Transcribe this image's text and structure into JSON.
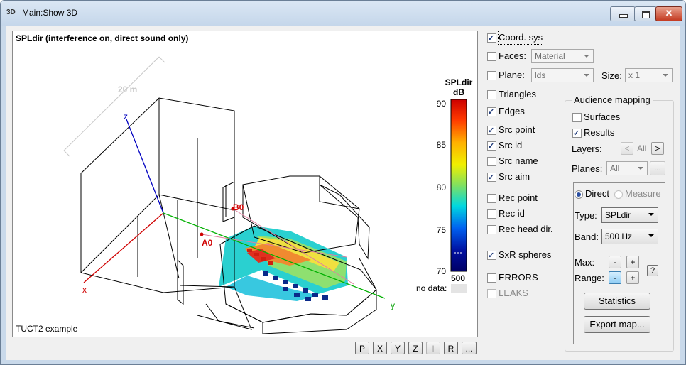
{
  "window": {
    "title": "Main:Show 3D",
    "icon_text": "3D",
    "close_glyph": "✕"
  },
  "viewport": {
    "title": "SPLdir (interference on, direct sound only)",
    "footer": "TUCT2 example",
    "scale_label": "20 m",
    "axis_labels": {
      "x": "x",
      "y": "y",
      "z": "z"
    },
    "source_labels": [
      "A0",
      "B0"
    ],
    "legend": {
      "title": "SPLdir",
      "unit": "dB",
      "ticks": [
        "90",
        "85",
        "80",
        "75",
        "70"
      ],
      "bottom_value": "500",
      "nodata_label": "no data:"
    }
  },
  "view_buttons": [
    "P",
    "X",
    "Y",
    "Z",
    "I",
    "R",
    "..."
  ],
  "options": {
    "coord_sys": {
      "label": "Coord. sys",
      "checked": true
    },
    "faces": {
      "label": "Faces:",
      "checked": false,
      "combo": "Material"
    },
    "plane": {
      "label": "Plane:",
      "checked": false,
      "combo": "lds"
    },
    "size": {
      "label": "Size:",
      "combo": "x 1"
    },
    "triangles": {
      "label": "Triangles",
      "checked": false
    },
    "edges": {
      "label": "Edges",
      "checked": true
    },
    "src_point": {
      "label": "Src point",
      "checked": true
    },
    "src_id": {
      "label": "Src id",
      "checked": true
    },
    "src_name": {
      "label": "Src name",
      "checked": false
    },
    "src_aim": {
      "label": "Src aim",
      "checked": true
    },
    "rec_point": {
      "label": "Rec point",
      "checked": false
    },
    "rec_id": {
      "label": "Rec id",
      "checked": false
    },
    "rec_head": {
      "label": "Rec head dir.",
      "checked": false
    },
    "sxr": {
      "label": "SxR spheres",
      "checked": true
    },
    "errors": {
      "label": "ERRORS",
      "checked": false
    },
    "leaks": {
      "label": "LEAKS",
      "checked": false
    }
  },
  "audience": {
    "title": "Audience mapping",
    "surfaces": {
      "label": "Surfaces",
      "checked": false
    },
    "results": {
      "label": "Results",
      "checked": true
    },
    "layers_label": "Layers:",
    "layers_value": "All",
    "planes_label": "Planes:",
    "planes_value": "All",
    "more": "...",
    "prev": "<",
    "next": ">",
    "direct": {
      "label": "Direct",
      "selected": true
    },
    "measure": {
      "label": "Measure",
      "selected": false
    },
    "type_label": "Type:",
    "type_value": "SPLdir",
    "band_label": "Band:",
    "band_value": "500 Hz",
    "max_label": "Max:",
    "range_label": "Range:",
    "minus": "-",
    "plus": "+",
    "help": "?",
    "statistics": "Statistics",
    "export": "Export map..."
  },
  "colors": {
    "accent": "#2a4fa1",
    "legend_top": "#cc0000",
    "legend_bottom": "#000066"
  }
}
